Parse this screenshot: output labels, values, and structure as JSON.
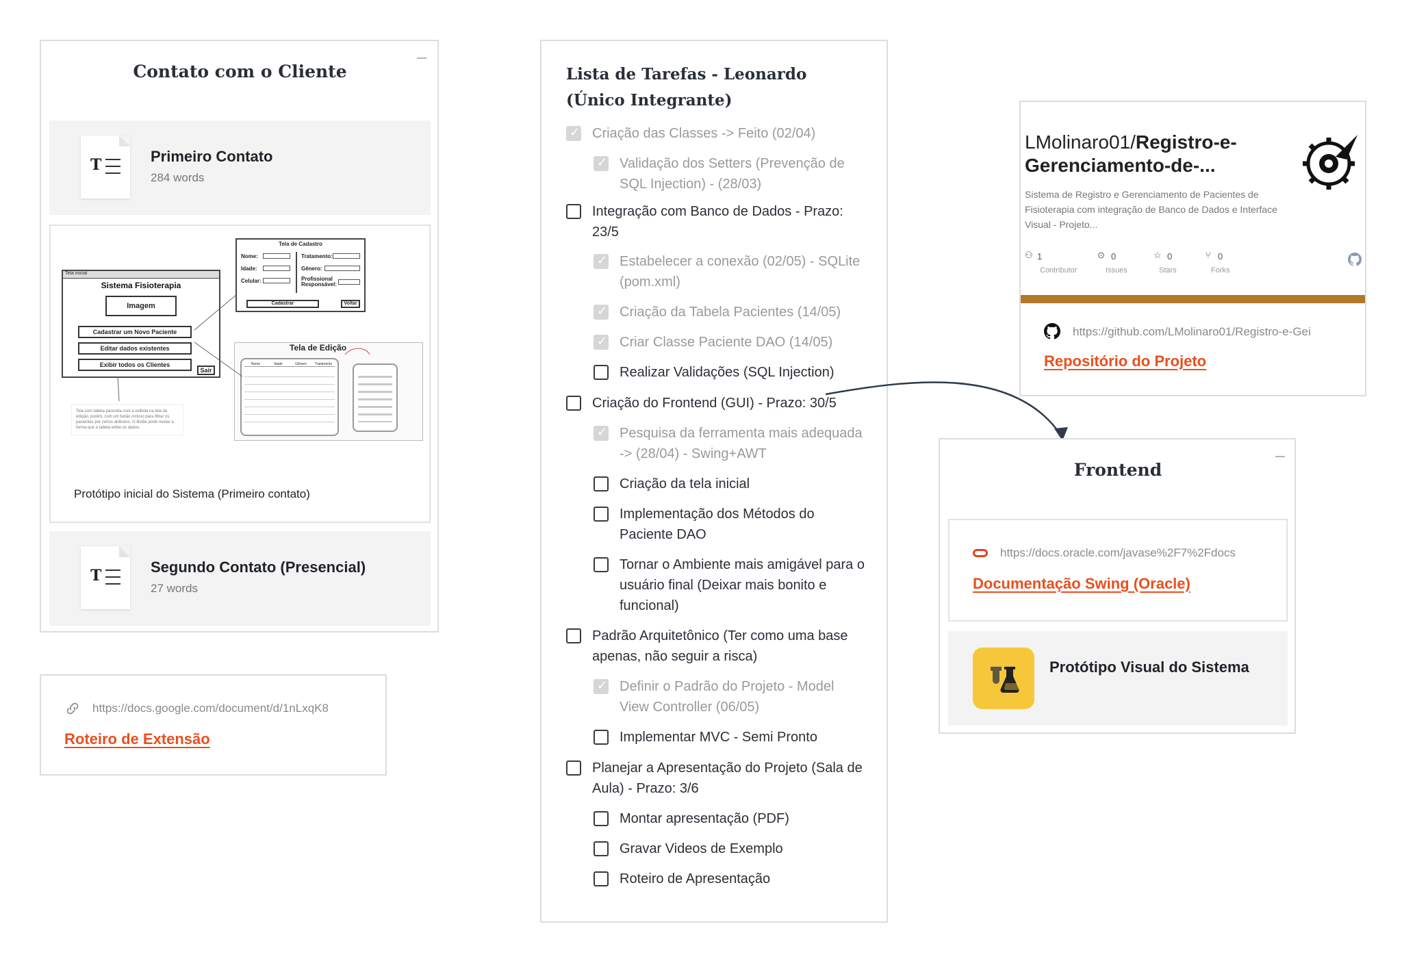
{
  "left_column": {
    "title": "Contato com o Cliente",
    "doc1": {
      "title": "Primeiro Contato",
      "words": "284 words"
    },
    "image_caption": "Protótipo inicial do Sistema (Primeiro contato)",
    "wireframe": {
      "main_window_title": "Sistema Fisioterapia",
      "main_window_bar": "Tela inicial",
      "image_label": "Imagem",
      "btn_new": "Cadastrar um Novo Paciente",
      "btn_edit": "Editar dados existentes",
      "btn_list": "Exibir todos os Clientes",
      "btn_exit": "Sair",
      "register_title": "Tela de Cadastro",
      "register_fields": [
        "Nome:",
        "Idade:",
        "Celular:"
      ],
      "register_fields_right": [
        "Tratamento:",
        "Gênero:",
        "Profissional Responsável:"
      ],
      "register_btn": "Cadastrar",
      "register_back": "Voltar",
      "edit_title": "Tela de Edição",
      "table_headers": [
        "Nome",
        "Idade",
        "Gênero",
        "Tratamento"
      ],
      "note": "Tela com tabela parecida com a exibida na tela de edição, porém, com um botão incluso para filtrar os pacientes por certos atributos. O Botão pode mudar a forma que a tabela exibe os dados."
    },
    "doc2": {
      "title": "Segundo Contato (Presencial)",
      "words": "27 words"
    },
    "link": {
      "url": "https://docs.google.com/document/d/1nLxqK8",
      "title": "Roteiro de Extensão",
      "icon": "link-icon"
    }
  },
  "middle_column": {
    "title": "Lista de Tarefas - Leonardo (Único Integrante)",
    "tasks": [
      {
        "text": "Criação das Classes -> Feito (02/04)",
        "done": true
      },
      {
        "text": "Validação dos Setters (Prevenção de SQL Injection) - (28/03)",
        "done": true
      },
      {
        "text": "Integração com Banco de Dados - Prazo: 23/5",
        "done": false
      },
      {
        "text": "Estabelecer a conexão (02/05) - SQLite (pom.xml)",
        "done": true
      },
      {
        "text": "Criação da Tabela Pacientes (14/05)",
        "done": true
      },
      {
        "text": "Criar Classe Paciente DAO (14/05)",
        "done": true
      },
      {
        "text": "Realizar Validações (SQL Injection)",
        "done": false
      },
      {
        "text": "Criação do Frontend (GUI) - Prazo: 30/5",
        "done": false
      },
      {
        "text": "Pesquisa da ferramenta mais adequada -> (28/04) - Swing+AWT",
        "done": true
      },
      {
        "text": "Criação da tela inicial",
        "done": false
      },
      {
        "text": "Implementação dos Métodos do Paciente DAO",
        "done": false
      },
      {
        "text": "Tornar o Ambiente mais amigável para o usuário final (Deixar mais bonito e funcional)",
        "done": false
      },
      {
        "text": "Padrão Arquitetônico (Ter como uma base apenas, não seguir a risca)",
        "done": false
      },
      {
        "text": "Definir o Padrão do Projeto - Model View Controller (06/05)",
        "done": true
      },
      {
        "text": "Implementar MVC - Semi Pronto",
        "done": false
      },
      {
        "text": "Planejar a Apresentação do Projeto (Sala de Aula) - Prazo: 3/6",
        "done": false
      },
      {
        "text": "Montar apresentação (PDF)",
        "done": false
      },
      {
        "text": "Gravar Videos de Exemplo",
        "done": false
      },
      {
        "text": "Roteiro de Apresentação",
        "done": false
      }
    ]
  },
  "github_card": {
    "repo_owner": "LMolinaro01/",
    "repo_name": "Registro-e-Gerenciamento-de-...",
    "description": "Sistema de Registro e Gerenciamento de Pacientes de Fisioterapia com integração de Banco de Dados e Interface Visual - Projeto...",
    "stats": [
      {
        "value": "1",
        "label": "Contributor"
      },
      {
        "value": "0",
        "label": "Issues"
      },
      {
        "value": "0",
        "label": "Stars"
      },
      {
        "value": "0",
        "label": "Forks"
      }
    ],
    "accent_color": "#b3782a",
    "url": "https://github.com/LMolinaro01/Registro-e-Gei",
    "title": "Repositório do Projeto",
    "icon": "github-icon"
  },
  "frontend_column": {
    "title": "Frontend",
    "link": {
      "url": "https://docs.oracle.com/javase%2F7%2Fdocs",
      "title": "Documentação Swing (Oracle)",
      "icon": "oracle-icon"
    },
    "app": {
      "title": "Protótipo Visual do Sistema",
      "icon": "lab-flask-icon",
      "icon_bg": "#f7c73b"
    }
  }
}
